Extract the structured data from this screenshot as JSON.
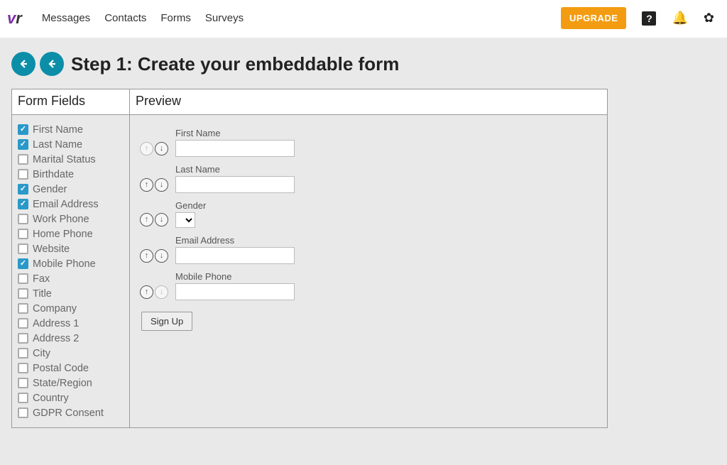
{
  "nav": {
    "links": [
      "Messages",
      "Contacts",
      "Forms",
      "Surveys"
    ],
    "upgrade_label": "UPGRADE"
  },
  "step": {
    "title": "Step 1: Create your embeddable form"
  },
  "panel": {
    "fields_header": "Form Fields",
    "preview_header": "Preview"
  },
  "fields": [
    {
      "label": "First Name",
      "checked": true
    },
    {
      "label": "Last Name",
      "checked": true
    },
    {
      "label": "Marital Status",
      "checked": false
    },
    {
      "label": "Birthdate",
      "checked": false
    },
    {
      "label": "Gender",
      "checked": true
    },
    {
      "label": "Email Address",
      "checked": true
    },
    {
      "label": "Work Phone",
      "checked": false
    },
    {
      "label": "Home Phone",
      "checked": false
    },
    {
      "label": "Website",
      "checked": false
    },
    {
      "label": "Mobile Phone",
      "checked": true
    },
    {
      "label": "Fax",
      "checked": false
    },
    {
      "label": "Title",
      "checked": false
    },
    {
      "label": "Company",
      "checked": false
    },
    {
      "label": "Address 1",
      "checked": false
    },
    {
      "label": "Address 2",
      "checked": false
    },
    {
      "label": "City",
      "checked": false
    },
    {
      "label": "Postal Code",
      "checked": false
    },
    {
      "label": "State/Region",
      "checked": false
    },
    {
      "label": "Country",
      "checked": false
    },
    {
      "label": "GDPR Consent",
      "checked": false
    }
  ],
  "preview": {
    "rows": [
      {
        "label": "First Name",
        "type": "text",
        "up_disabled": true,
        "down_disabled": false
      },
      {
        "label": "Last Name",
        "type": "text",
        "up_disabled": false,
        "down_disabled": false
      },
      {
        "label": "Gender",
        "type": "select",
        "up_disabled": false,
        "down_disabled": false
      },
      {
        "label": "Email Address",
        "type": "text",
        "up_disabled": false,
        "down_disabled": false
      },
      {
        "label": "Mobile Phone",
        "type": "text",
        "up_disabled": false,
        "down_disabled": true
      }
    ],
    "submit_label": "Sign Up"
  }
}
